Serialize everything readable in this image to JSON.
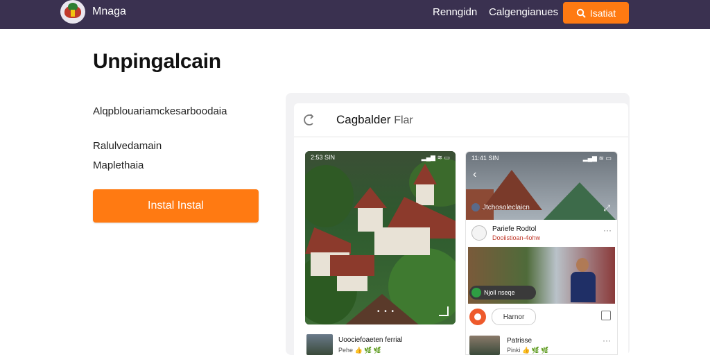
{
  "header": {
    "brand": "Mnaga",
    "nav": [
      "Renngidn",
      "Calgengianues"
    ],
    "cta_label": "Isatiat",
    "cta_icon": "search-icon"
  },
  "hero": {
    "heading": "Unpingalcain",
    "subline": "Alqpblouariamckesarboodaia",
    "lines": [
      "Ralulvedamain",
      "Maplethaia"
    ],
    "install_label": "Instal Instal"
  },
  "panel": {
    "back_icon": "refresh-icon",
    "title": "Cagbalder",
    "title_suffix": "Flar"
  },
  "phone1": {
    "status_time": "2:53 SIN",
    "status_icons": "▂▄▆ ≋ ▭",
    "card": {
      "name": "Uoociefoaeten ferrial",
      "meta": "Pehe 👍 🌿 🌿"
    }
  },
  "phone2": {
    "status_time": "11:41 SIN",
    "status_icons": "▂▄▆ ≋ ▭",
    "image_caption": "Jtchosoleclaicn",
    "post": {
      "name": "Pariefe Rodtol",
      "meta": "Dooiistioan-4ohw"
    },
    "badge_label": "Njoll nseqe",
    "reply_label": "Harnor",
    "post2": {
      "name": "Patrisse",
      "meta": "Pinki 👍 🌿 🌿"
    }
  },
  "colors": {
    "topbar": "#3a3150",
    "accent": "#ff7a12"
  }
}
